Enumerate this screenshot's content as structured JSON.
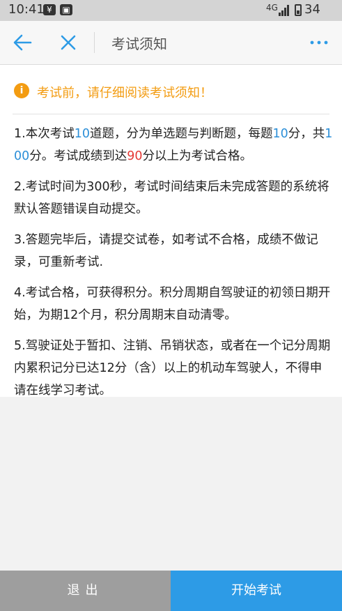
{
  "status_bar": {
    "time": "10:41",
    "network": "4G",
    "battery": "34"
  },
  "nav": {
    "title": "考试须知"
  },
  "notice": {
    "icon": "i",
    "text": "考试前，请仔细阅读考试须知！"
  },
  "rules": {
    "r1": {
      "a": "1.本次考试",
      "n1": "10",
      "b": "道题，分为单选题与判断题，每题",
      "n2": "10",
      "c": "分，共",
      "n3": "100",
      "d": "分。考试成绩到达",
      "n4": "90",
      "e": "分以上为考试合格。"
    },
    "r2": "2.考试时间为300秒，考试时间结束后未完成答题的系统将默认答题错误自动提交。",
    "r3": "3.答题完毕后，请提交试卷，如考试不合格，成绩不做记录，可重新考试.",
    "r4": "4.考试合格，可获得积分。积分周期自驾驶证的初领日期开始，为期12个月，积分周期末自动清零。",
    "r5": "5.驾驶证处于暂扣、注销、吊销状态，或者在一个记分周期内累积记分已达12分（含）以上的机动车驾驶人，不得申请在线学习考试。"
  },
  "footer": {
    "exit_label": "退出",
    "start_label": "开始考试"
  },
  "colors": {
    "accent_blue": "#2d9be6",
    "highlight_blue": "#2c8fd8",
    "highlight_red": "#e53935",
    "notice_orange": "#f39c12"
  }
}
